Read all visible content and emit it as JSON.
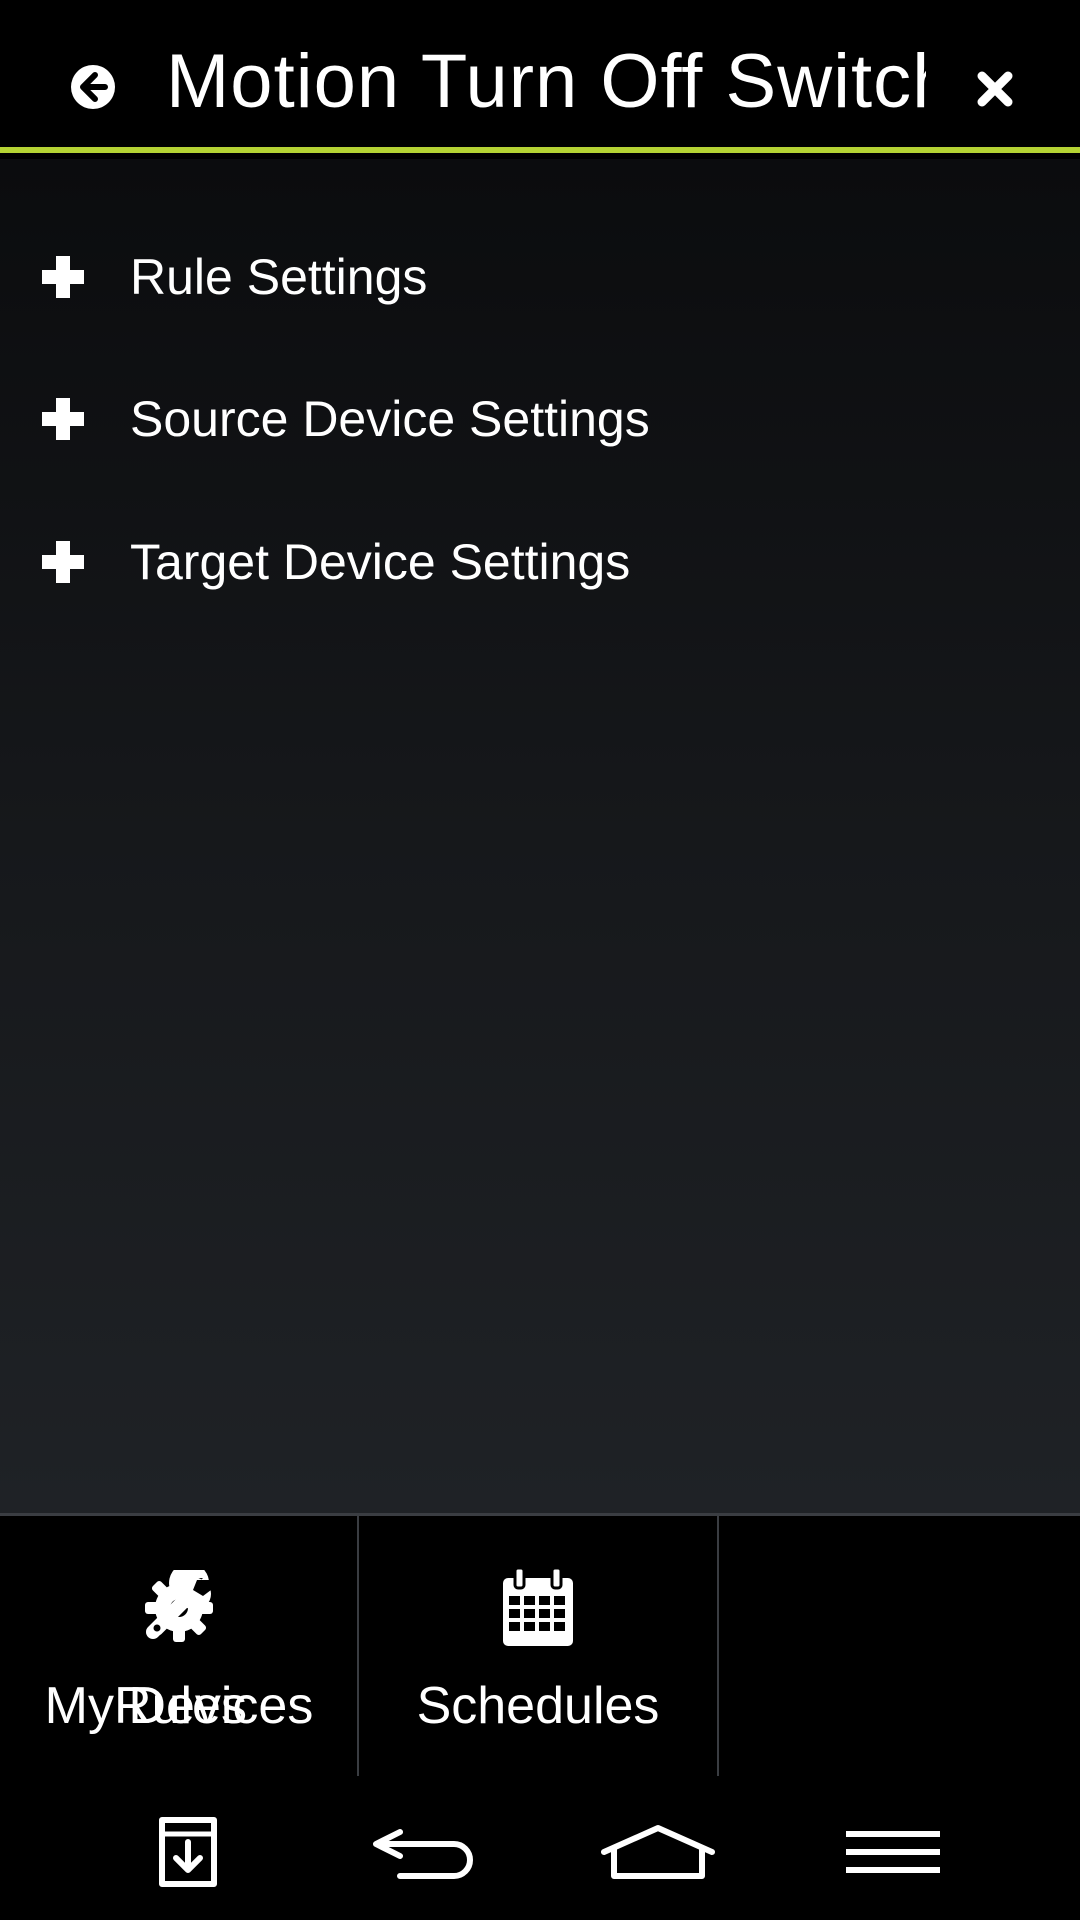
{
  "header": {
    "title": "Motion Turn Off Switch",
    "back_icon": "back-arrow-circle-icon",
    "close_icon": "close-icon",
    "accent_color": "#b5d334"
  },
  "sections": [
    {
      "label": "Rule Settings",
      "icon": "plus-icon",
      "expanded": false
    },
    {
      "label": "Source Device Settings",
      "icon": "plus-icon",
      "expanded": false
    },
    {
      "label": "Target Device Settings",
      "icon": "plus-icon",
      "expanded": false
    }
  ],
  "bottom_nav": {
    "items": [
      {
        "label": "My Devices",
        "icon": "gear-icon"
      },
      {
        "label": "Schedules",
        "icon": "calendar-icon"
      },
      {
        "label": "Rules",
        "icon": "wrench-icon"
      }
    ]
  },
  "system_bar": {
    "buttons": [
      "download-icon",
      "back-icon",
      "home-icon",
      "menu-icon"
    ]
  }
}
